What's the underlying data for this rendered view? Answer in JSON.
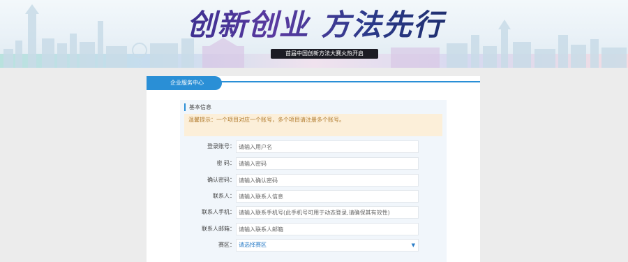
{
  "banner": {
    "slogan": "创新创业 方法先行",
    "sub_slogan": "首届中国创新方法大赛火热开启"
  },
  "panel": {
    "tab_label": "企业服务中心",
    "section_title": "基本信息",
    "tip": "温馨提示：一个项目对应一个账号，多个项目请注册多个账号。"
  },
  "form": {
    "fields": [
      {
        "label": "登录账号：",
        "placeholder": "请输入用户名"
      },
      {
        "label": "密 码：",
        "placeholder": "请输入密码"
      },
      {
        "label": "确认密码：",
        "placeholder": "请输入确认密码"
      },
      {
        "label": "联系人：",
        "placeholder": "请输入联系人信息"
      },
      {
        "label": "联系人手机：",
        "placeholder": "请输入联系手机号(此手机号可用于动态登录,请确保其有效性)"
      },
      {
        "label": "联系人邮箱：",
        "placeholder": "请输入联系人邮箱"
      }
    ],
    "region": {
      "label": "赛区：",
      "selected": "请选择赛区"
    }
  },
  "colors": {
    "accent": "#2a8fd6",
    "tip_bg": "#fcefd9",
    "tip_text": "#b07a2c",
    "page_bg": "#ececec"
  }
}
